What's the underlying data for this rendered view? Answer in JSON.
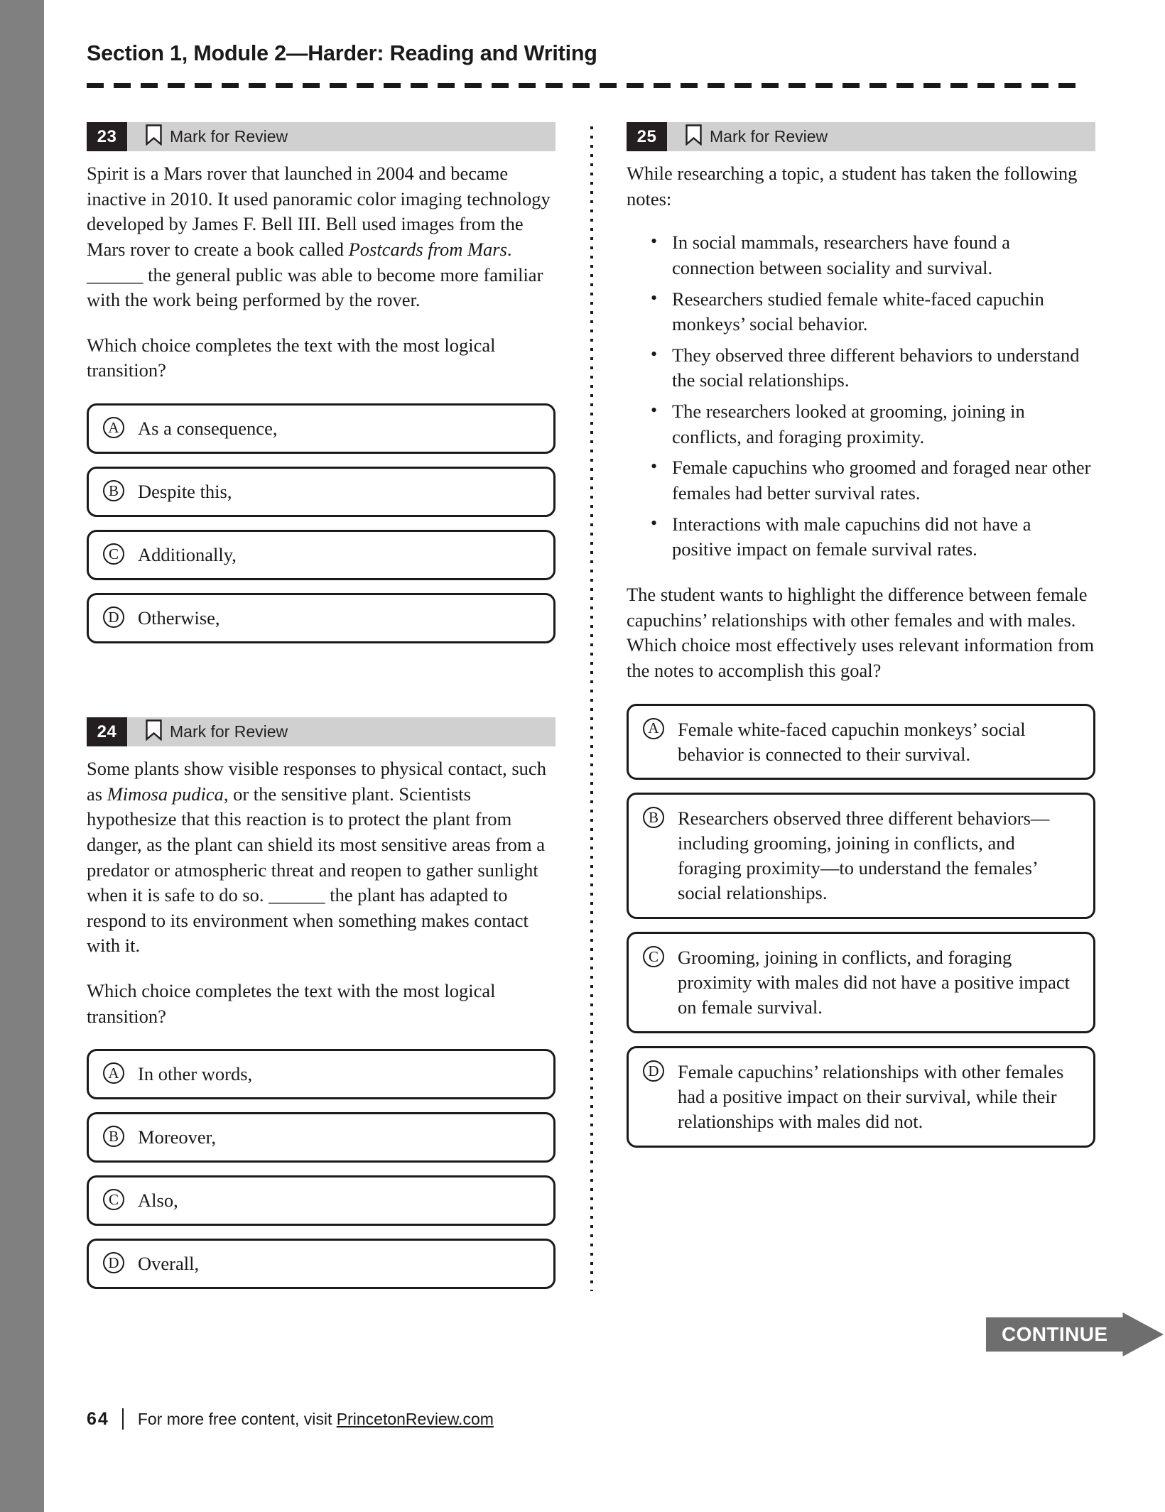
{
  "header": {
    "section_title": "Section 1, Module 2—Harder: Reading and Writing"
  },
  "mark_for_review_label": "Mark for Review",
  "questions": [
    {
      "number": "23",
      "column": "left",
      "passage_html": "Spirit is a Mars rover that launched in 2004 and became inactive in 2010. It used panoramic color imaging technology developed by James F. Bell III. Bell used images from the Mars rover to create a book called <em>Postcards from Mars</em>. ______ the general public was able to become more familiar with the work being performed by the rover.",
      "prompt": "Which choice completes the text with the most logical transition?",
      "choices": [
        {
          "letter": "A",
          "text": "As a consequence,"
        },
        {
          "letter": "B",
          "text": "Despite this,"
        },
        {
          "letter": "C",
          "text": "Additionally,"
        },
        {
          "letter": "D",
          "text": "Otherwise,"
        }
      ]
    },
    {
      "number": "24",
      "column": "left",
      "passage_html": "Some plants show visible responses to physical contact, such as <em>Mimosa pudica</em>, or the sensitive plant. Scientists hypothesize that this reaction is to protect the plant from danger, as the plant can shield its most sensitive areas from a predator or atmospheric threat and reopen to gather sunlight when it is safe to do so. ______ the plant has adapted to respond to its environment when something makes contact with it.",
      "prompt": "Which choice completes the text with the most logical transition?",
      "choices": [
        {
          "letter": "A",
          "text": "In other words,"
        },
        {
          "letter": "B",
          "text": "Moreover,"
        },
        {
          "letter": "C",
          "text": "Also,"
        },
        {
          "letter": "D",
          "text": "Overall,"
        }
      ]
    },
    {
      "number": "25",
      "column": "right",
      "intro": "While researching a topic, a student has taken the following notes:",
      "notes": [
        "In social mammals, researchers have found a connection between sociality and survival.",
        "Researchers studied female white-faced capuchin monkeys’ social behavior.",
        "They observed three different behaviors to understand the social relationships.",
        "The researchers looked at grooming, joining in conflicts, and foraging proximity.",
        "Female capuchins who groomed and foraged near other females had better survival rates.",
        "Interactions with male capuchins did not have a positive impact on female survival rates."
      ],
      "prompt": "The student wants to highlight the difference between female capuchins’ relationships with other females and with males. Which choice most effectively uses relevant information from the notes to accomplish this goal?",
      "choices": [
        {
          "letter": "A",
          "text": "Female white-faced capuchin monkeys’ social behavior is connected to their survival."
        },
        {
          "letter": "B",
          "text": "Researchers observed three different behaviors—including grooming, joining in conflicts, and foraging proximity—to understand the females’ social relationships."
        },
        {
          "letter": "C",
          "text": "Grooming, joining in conflicts, and foraging proximity with males did not have a positive impact on female survival."
        },
        {
          "letter": "D",
          "text": "Female capuchins’ relationships with other females had a positive impact on their survival, while their relationships with males did not."
        }
      ]
    }
  ],
  "continue_button": {
    "label": "CONTINUE"
  },
  "footer": {
    "page_number": "64",
    "text_before_link": "For more free content, visit ",
    "link_text": "PrincetonReview.com"
  },
  "colors": {
    "margin_bar": "#808080",
    "question_number_bg": "#231f20",
    "question_head_bg": "#d0d0d0",
    "continue_bg": "#6e6e6e",
    "text": "#1a1a1a"
  }
}
